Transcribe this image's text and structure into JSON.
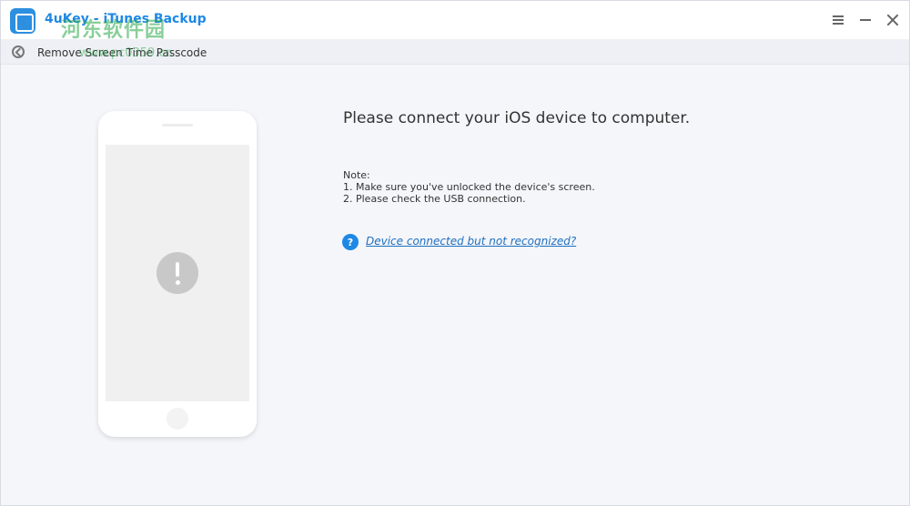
{
  "app": {
    "title": "4uKey - iTunes Backup",
    "watermark": "河东软件园",
    "url_watermark": "www.pc0359.cn"
  },
  "window_controls": {
    "menu_icon": "hamburger-icon",
    "minimize_icon": "minimize-icon",
    "close_icon": "close-icon"
  },
  "subbar": {
    "back_icon": "back-icon",
    "breadcrumb": "Remove Screen Time Passcode"
  },
  "phone": {
    "alert_icon": "exclamation-icon"
  },
  "main": {
    "headline": "Please connect your iOS device to computer.",
    "note_title": "Note:",
    "notes": [
      "1. Make sure you've unlocked the device's screen.",
      "2. Please check the USB connection."
    ],
    "help_icon_glyph": "?",
    "help_link": "Device connected but not recognized?"
  },
  "colors": {
    "accent": "#1e88e5",
    "background": "#f5f6fa"
  }
}
